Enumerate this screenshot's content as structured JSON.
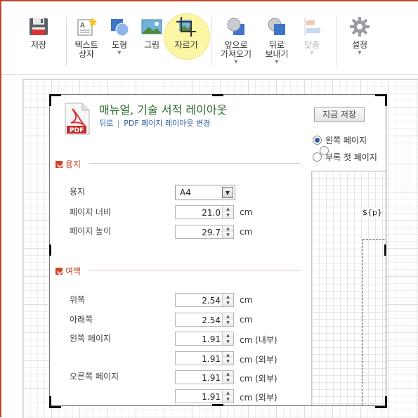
{
  "toolbar": {
    "save": "저장",
    "textbox": "텍스트\n상자",
    "shape": "도형",
    "picture": "그림",
    "crop": "자르기",
    "bring_forward": "앞으로\n가져오기",
    "send_backward": "뒤로\n보내기",
    "align": "맞춤",
    "settings": "설정"
  },
  "dialog": {
    "title": "매뉴얼, 기술 서적 레이아웃",
    "back_link": "뒤로",
    "change_layout_link": "PDF 페이지 레이아웃 변경",
    "save_now": "지금 저장",
    "radio_left_page": "왼쪽 페이지",
    "radio_appendix_first": "부록 첫 페이지",
    "section_paper": "용지",
    "section_margin": "여백",
    "paper_label": "용지",
    "paper_value": "A4",
    "page_width_label": "페이지 너비",
    "page_width_value": "21.0",
    "page_height_label": "페이지 높이",
    "page_height_value": "29.7",
    "top_label": "위쪽",
    "top_value": "2.54",
    "bottom_label": "아래쪽",
    "bottom_value": "2.54",
    "left_page_label": "왼쪽 페이지",
    "left_inner_value": "1.91",
    "left_outer_value": "1.91",
    "right_page_label": "오른쪽 페이지",
    "right_inner_value": "1.91",
    "right_outer_value": "1.91",
    "unit_cm": "cm",
    "unit_cm_inner": "cm (내부)",
    "unit_cm_outer": "cm (외부)",
    "preview_placeholder": "${p}"
  },
  "colors": {
    "accent": "#c0462a",
    "title_green": "#2a6a32",
    "link_blue": "#2a5aa0",
    "crop_highlight": "#fbf5a4"
  }
}
